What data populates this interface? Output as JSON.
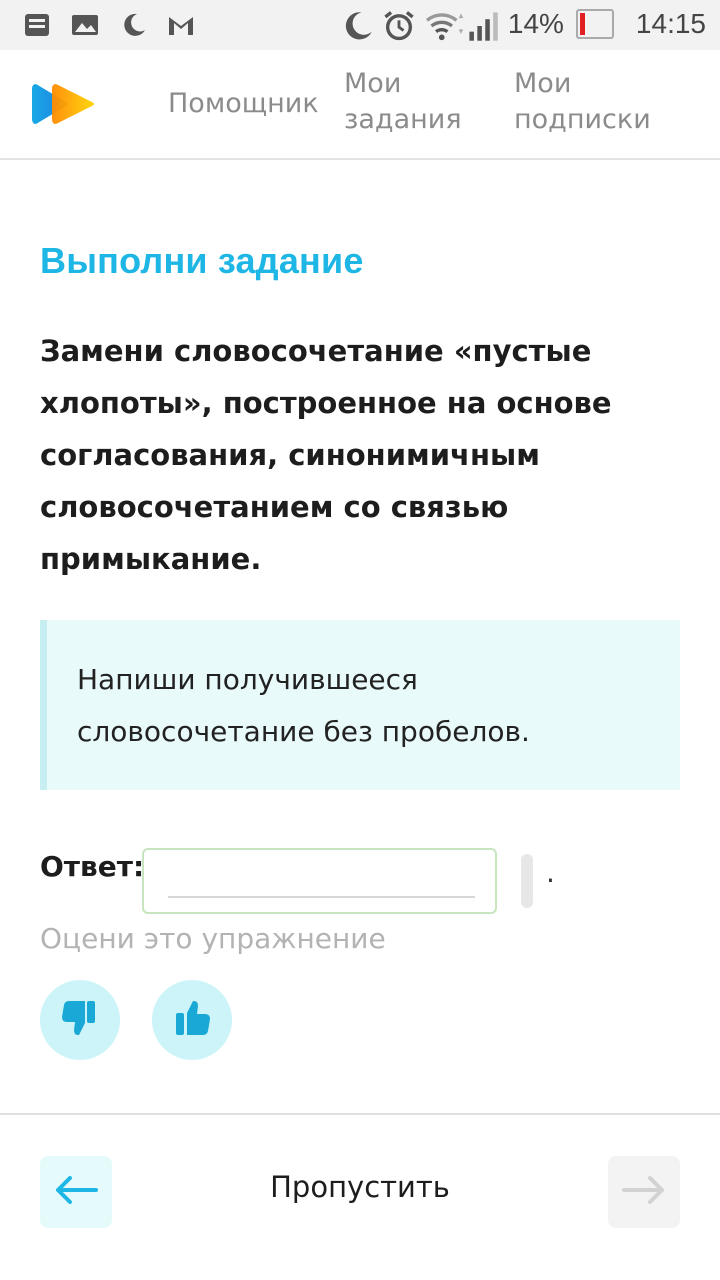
{
  "status_bar": {
    "left_icons": [
      "notification-list-icon",
      "image-icon",
      "moon-icon",
      "gmail-icon"
    ],
    "right_icons": [
      "moon-icon",
      "alarm-icon",
      "wifi-icon",
      "signal-icon",
      "battery-icon"
    ],
    "battery_percent": "14%",
    "time": "14:15"
  },
  "header": {
    "nav": {
      "helper": "Помощник",
      "tasks": "Мои задания",
      "subscriptions": "Мои подписки"
    }
  },
  "main": {
    "title": "Выполни задание",
    "task_text": "Замени словосочетание «пустые хлопоты», построенное на основе согласования, синонимичным словосочетанием со связью примыкание.",
    "hint": "Напиши получившееся словосочетание без пробелов.",
    "answer_label": "Ответ:",
    "answer_value": "",
    "trailing_dot": ".",
    "rate_label": "Оцени это упражнение"
  },
  "footer": {
    "skip_label": "Пропустить"
  },
  "colors": {
    "accent": "#1eb6e4",
    "hint_bg": "#e9fafb",
    "rate_btn_bg": "#cdf4f8",
    "icon_blue": "#1aa9d6"
  }
}
